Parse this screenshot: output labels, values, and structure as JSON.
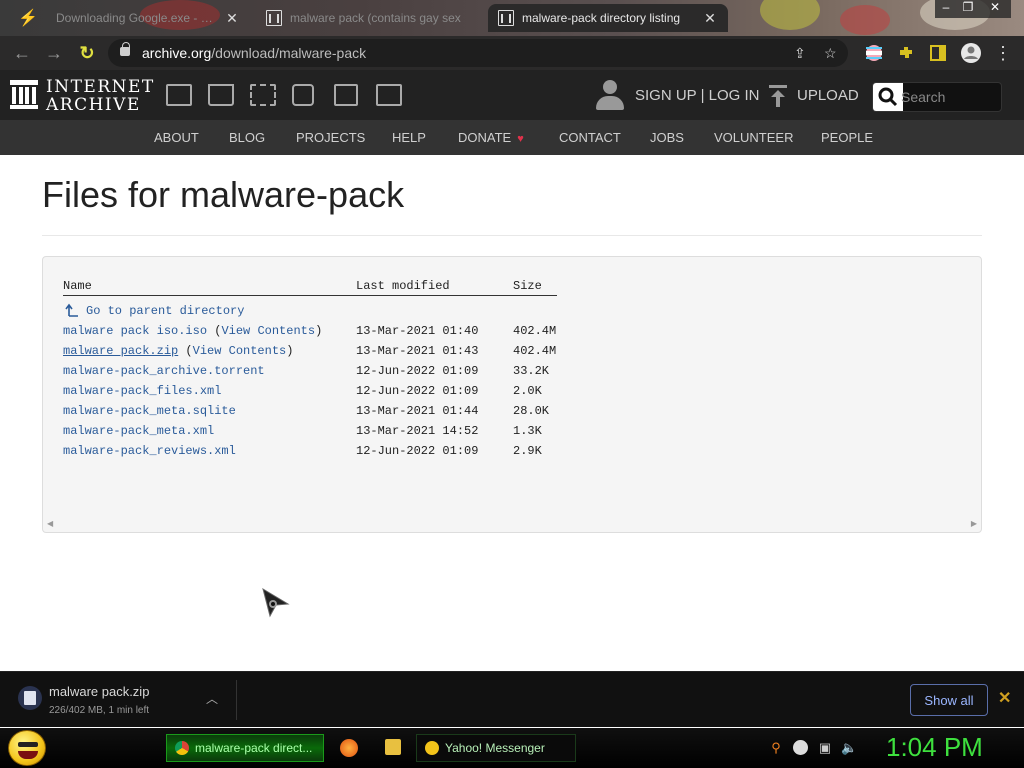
{
  "browser": {
    "tabs": [
      {
        "title": "Downloading Google.exe - Dan...",
        "active": false
      },
      {
        "title": "malware pack (contains gay sex",
        "active": false
      },
      {
        "title": "malware-pack directory listing",
        "active": true
      }
    ],
    "url_domain": "archive.org",
    "url_path": "/download/malware-pack"
  },
  "site": {
    "logo_line1": "INTERNET",
    "logo_line2": "ARCHIVE",
    "signup_login": "SIGN UP | LOG IN",
    "upload": "UPLOAD",
    "search_placeholder": "Search",
    "nav": [
      "ABOUT",
      "BLOG",
      "PROJECTS",
      "HELP",
      "DONATE",
      "CONTACT",
      "JOBS",
      "VOLUNTEER",
      "PEOPLE"
    ]
  },
  "page": {
    "title": "Files for malware-pack",
    "columns": {
      "name": "Name",
      "modified": "Last modified",
      "size": "Size"
    },
    "parent_link": "Go to parent directory",
    "view_contents": "View Contents",
    "files": [
      {
        "name": "malware pack iso.iso",
        "view": true,
        "modified": "13-Mar-2021 01:40",
        "size": "402.4M",
        "underlined": false
      },
      {
        "name": "malware pack.zip",
        "view": true,
        "modified": "13-Mar-2021 01:43",
        "size": "402.4M",
        "underlined": true
      },
      {
        "name": "malware-pack_archive.torrent",
        "view": false,
        "modified": "12-Jun-2022 01:09",
        "size": "33.2K",
        "underlined": false
      },
      {
        "name": "malware-pack_files.xml",
        "view": false,
        "modified": "12-Jun-2022 01:09",
        "size": "2.0K",
        "underlined": false
      },
      {
        "name": "malware-pack_meta.sqlite",
        "view": false,
        "modified": "13-Mar-2021 01:44",
        "size": "28.0K",
        "underlined": false
      },
      {
        "name": "malware-pack_meta.xml",
        "view": false,
        "modified": "13-Mar-2021 14:52",
        "size": "1.3K",
        "underlined": false
      },
      {
        "name": "malware-pack_reviews.xml",
        "view": false,
        "modified": "12-Jun-2022 01:09",
        "size": "2.9K",
        "underlined": false
      }
    ]
  },
  "download": {
    "filename": "malware pack.zip",
    "progress_text": "226/402 MB, 1 min left",
    "show_all": "Show all"
  },
  "taskbar": {
    "tasks": [
      {
        "label": "malware-pack direct...",
        "active": true
      },
      {
        "label": "Yahoo! Messenger",
        "active": false
      }
    ],
    "clock": "1:04 PM"
  },
  "colors": {
    "link": "#2a5b9a",
    "clock": "#3ee03e",
    "heart": "#e0324b",
    "header_bg": "#222222",
    "nav_bg": "#333333"
  }
}
